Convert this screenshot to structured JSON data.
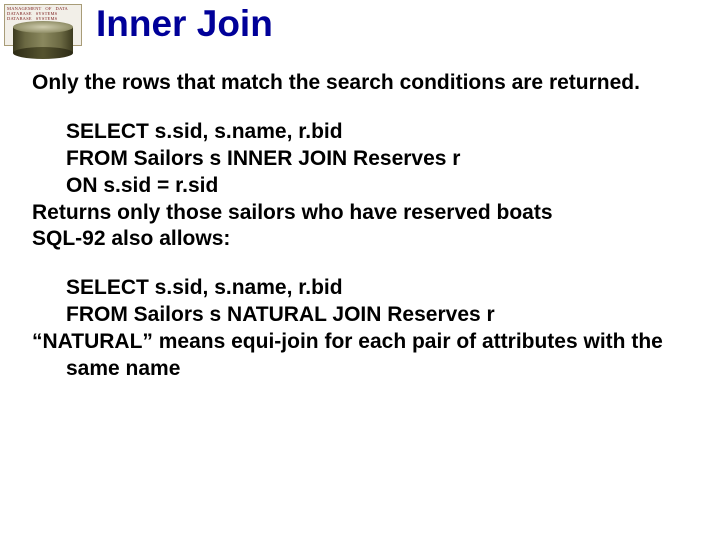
{
  "logo": {
    "line1": "MANAGEMENT   OF   DATA",
    "line2": "DATABASE   SYSTEMS",
    "line3": "DATABASE   SYSTEMS"
  },
  "title": "Inner Join",
  "intro": "Only the rows that match the search conditions are returned.",
  "sql1": {
    "l1": "SELECT s.sid, s.name, r.bid",
    "l2": "FROM Sailors s INNER JOIN Reserves r",
    "l3": "ON s.sid = r.sid"
  },
  "note1": "Returns only those sailors who have reserved boats",
  "note2": "SQL-92 also allows:",
  "sql2": {
    "l1": "SELECT s.sid, s.name, r.bid",
    "l2": "FROM Sailors s NATURAL JOIN Reserves r"
  },
  "note3": "“NATURAL” means equi-join for each pair of attributes with the same name"
}
